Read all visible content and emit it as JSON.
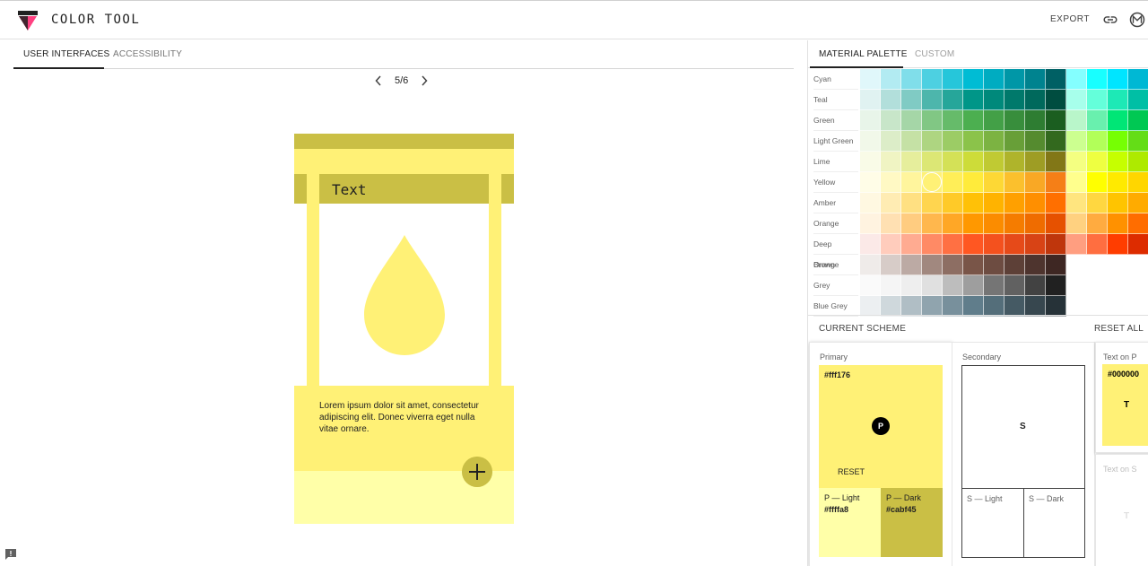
{
  "header": {
    "title": "COLOR TOOL",
    "export_label": "EXPORT",
    "link_icon": "link-icon",
    "material_icon": "material-logo-icon"
  },
  "left_tabs": [
    {
      "label": "USER INTERFACES",
      "active": true
    },
    {
      "label": "ACCESSIBILITY",
      "active": false
    }
  ],
  "pager": {
    "label": "5/6"
  },
  "preview": {
    "card_title": "Text",
    "body_text": "Lorem ipsum dolor sit amet, consectetur adipiscing elit. Donec viverra eget nulla vitae ornare.",
    "fab_icon": "plus-icon",
    "drop_icon": "water-drop-icon"
  },
  "right_tabs": [
    {
      "label": "MATERIAL PALETTE",
      "active": true
    },
    {
      "label": "CUSTOM",
      "active": false
    }
  ],
  "palette": {
    "selected": {
      "row": 5,
      "col": 3
    },
    "rows": [
      {
        "name": "Cyan",
        "colors": [
          "#e0f7fa",
          "#b2ebf2",
          "#80deea",
          "#4dd0e1",
          "#26c6da",
          "#00bcd4",
          "#00acc1",
          "#0097a7",
          "#00838f",
          "#006064",
          "#84ffff",
          "#18ffff",
          "#00e5ff",
          "#00b8d4"
        ]
      },
      {
        "name": "Teal",
        "colors": [
          "#e0f2f1",
          "#b2dfdb",
          "#80cbc4",
          "#4db6ac",
          "#26a69a",
          "#009688",
          "#00897b",
          "#00796b",
          "#00695c",
          "#004d40",
          "#a7ffeb",
          "#64ffda",
          "#1de9b6",
          "#00bfa5"
        ]
      },
      {
        "name": "Green",
        "colors": [
          "#e8f5e9",
          "#c8e6c9",
          "#a5d6a7",
          "#81c784",
          "#66bb6a",
          "#4caf50",
          "#43a047",
          "#388e3c",
          "#2e7d32",
          "#1b5e20",
          "#b9f6ca",
          "#69f0ae",
          "#00e676",
          "#00c853"
        ]
      },
      {
        "name": "Light Green",
        "colors": [
          "#f1f8e9",
          "#dcedc8",
          "#c5e1a5",
          "#aed581",
          "#9ccc65",
          "#8bc34a",
          "#7cb342",
          "#689f38",
          "#558b2f",
          "#33691e",
          "#ccff90",
          "#b2ff59",
          "#76ff03",
          "#64dd17"
        ]
      },
      {
        "name": "Lime",
        "colors": [
          "#f9fbe7",
          "#f0f4c3",
          "#e6ee9c",
          "#dce775",
          "#d4e157",
          "#cddc39",
          "#c0ca33",
          "#afb42b",
          "#9e9d24",
          "#827717",
          "#f4ff81",
          "#eeff41",
          "#c6ff00",
          "#aeea00"
        ]
      },
      {
        "name": "Yellow",
        "colors": [
          "#fffde7",
          "#fff9c4",
          "#fff59d",
          "#fff176",
          "#ffee58",
          "#ffeb3b",
          "#fdd835",
          "#fbc02d",
          "#f9a825",
          "#f57f17",
          "#ffff8d",
          "#ffff00",
          "#ffea00",
          "#ffd600"
        ]
      },
      {
        "name": "Amber",
        "colors": [
          "#fff8e1",
          "#ffecb3",
          "#ffe082",
          "#ffd54f",
          "#ffca28",
          "#ffc107",
          "#ffb300",
          "#ffa000",
          "#ff8f00",
          "#ff6f00",
          "#ffe57f",
          "#ffd740",
          "#ffc400",
          "#ffab00"
        ]
      },
      {
        "name": "Orange",
        "colors": [
          "#fff3e0",
          "#ffe0b2",
          "#ffcc80",
          "#ffb74d",
          "#ffa726",
          "#ff9800",
          "#fb8c00",
          "#f57c00",
          "#ef6c00",
          "#e65100",
          "#ffd180",
          "#ffab40",
          "#ff9100",
          "#ff6d00"
        ]
      },
      {
        "name": "Deep Orange",
        "colors": [
          "#fbe9e7",
          "#ffccbc",
          "#ffab91",
          "#ff8a65",
          "#ff7043",
          "#ff5722",
          "#f4511e",
          "#e64a19",
          "#d84315",
          "#bf360c",
          "#ff9e80",
          "#ff6e40",
          "#ff3d00",
          "#dd2c00"
        ]
      },
      {
        "name": "Brown",
        "colors": [
          "#efebe9",
          "#d7ccc8",
          "#bcaaa4",
          "#a1887f",
          "#8d6e63",
          "#795548",
          "#6d4c41",
          "#5d4037",
          "#4e342e",
          "#3e2723"
        ]
      },
      {
        "name": "Grey",
        "colors": [
          "#fafafa",
          "#f5f5f5",
          "#eeeeee",
          "#e0e0e0",
          "#bdbdbd",
          "#9e9e9e",
          "#757575",
          "#616161",
          "#424242",
          "#212121"
        ]
      },
      {
        "name": "Blue Grey",
        "colors": [
          "#eceff1",
          "#cfd8dc",
          "#b0bec5",
          "#90a4ae",
          "#78909c",
          "#607d8b",
          "#546e7a",
          "#455a64",
          "#37474f",
          "#263238"
        ]
      }
    ]
  },
  "scheme": {
    "title": "CURRENT SCHEME",
    "reset_all": "RESET ALL",
    "primary": {
      "label": "Primary",
      "hex": "#fff176",
      "badge": "P",
      "reset": "RESET",
      "light_label": "P — Light",
      "light_hex": "#ffffa8",
      "dark_label": "P — Dark",
      "dark_hex": "#cabf45"
    },
    "secondary": {
      "label": "Secondary",
      "badge": "S",
      "light_label": "S — Light",
      "dark_label": "S — Dark"
    },
    "text_on_p": {
      "label": "Text on P",
      "hex": "#000000",
      "letter": "T"
    },
    "text_on_s": {
      "label": "Text on S",
      "letter": "T"
    }
  }
}
